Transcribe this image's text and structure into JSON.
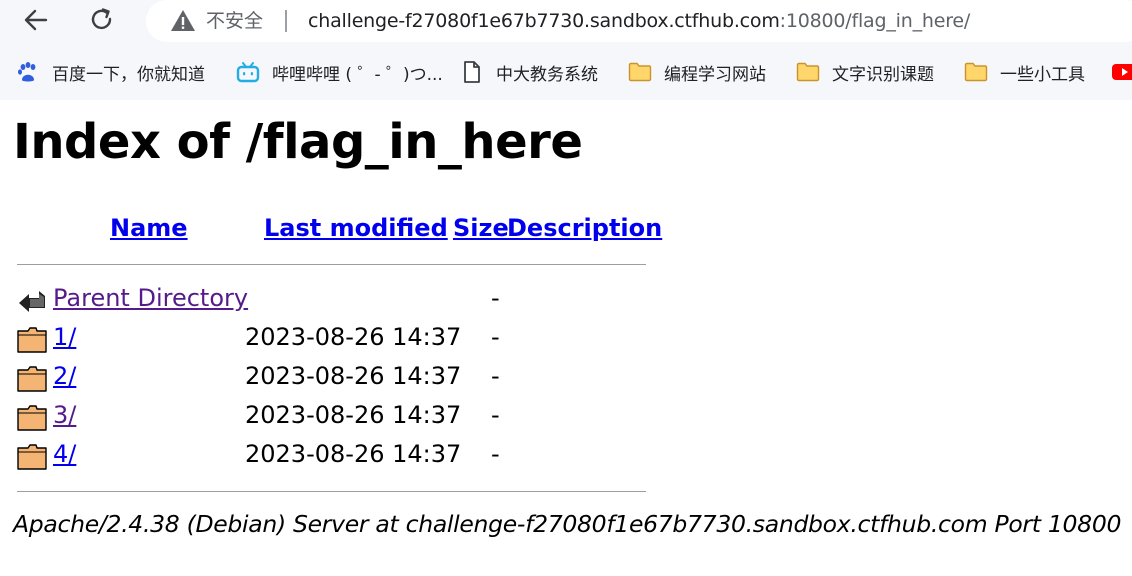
{
  "browser": {
    "security_label": "不安全",
    "url_host": "challenge-f27080f1e67b7730.sandbox.ctfhub.com",
    "url_rest": ":10800/flag_in_here/",
    "bookmarks": [
      {
        "label": "百度一下，你就知道",
        "icon": "baidu-paw-icon"
      },
      {
        "label": "哔哩哔哩 ( ゜- ゜)つ...",
        "icon": "bilibili-tv-icon"
      },
      {
        "label": "中大教务系统",
        "icon": "page-icon"
      },
      {
        "label": "编程学习网站",
        "icon": "folder-icon"
      },
      {
        "label": "文字识别课题",
        "icon": "folder-icon"
      },
      {
        "label": "一些小工具",
        "icon": "folder-icon"
      }
    ]
  },
  "page": {
    "title": "Index of /flag_in_here",
    "columns": {
      "name": "Name",
      "last_modified": "Last modified",
      "size": "Size",
      "description": "Description"
    },
    "rows": [
      {
        "name": "Parent Directory",
        "modified": "",
        "size": "-",
        "icon": "back-arrow-icon"
      },
      {
        "name": "1/",
        "modified": "2023-08-26 14:37",
        "size": "-",
        "icon": "folder-icon"
      },
      {
        "name": "2/",
        "modified": "2023-08-26 14:37",
        "size": "-",
        "icon": "folder-icon"
      },
      {
        "name": "3/",
        "modified": "2023-08-26 14:37",
        "size": "-",
        "icon": "folder-icon"
      },
      {
        "name": "4/",
        "modified": "2023-08-26 14:37",
        "size": "-",
        "icon": "folder-icon"
      }
    ],
    "footer": "Apache/2.4.38 (Debian) Server at challenge-f27080f1e67b7730.sandbox.ctfhub.com Port 10800"
  },
  "colors": {
    "link": "#0000ee",
    "visited_link": "#551a8b",
    "chrome_bg": "#f5f7fb"
  }
}
